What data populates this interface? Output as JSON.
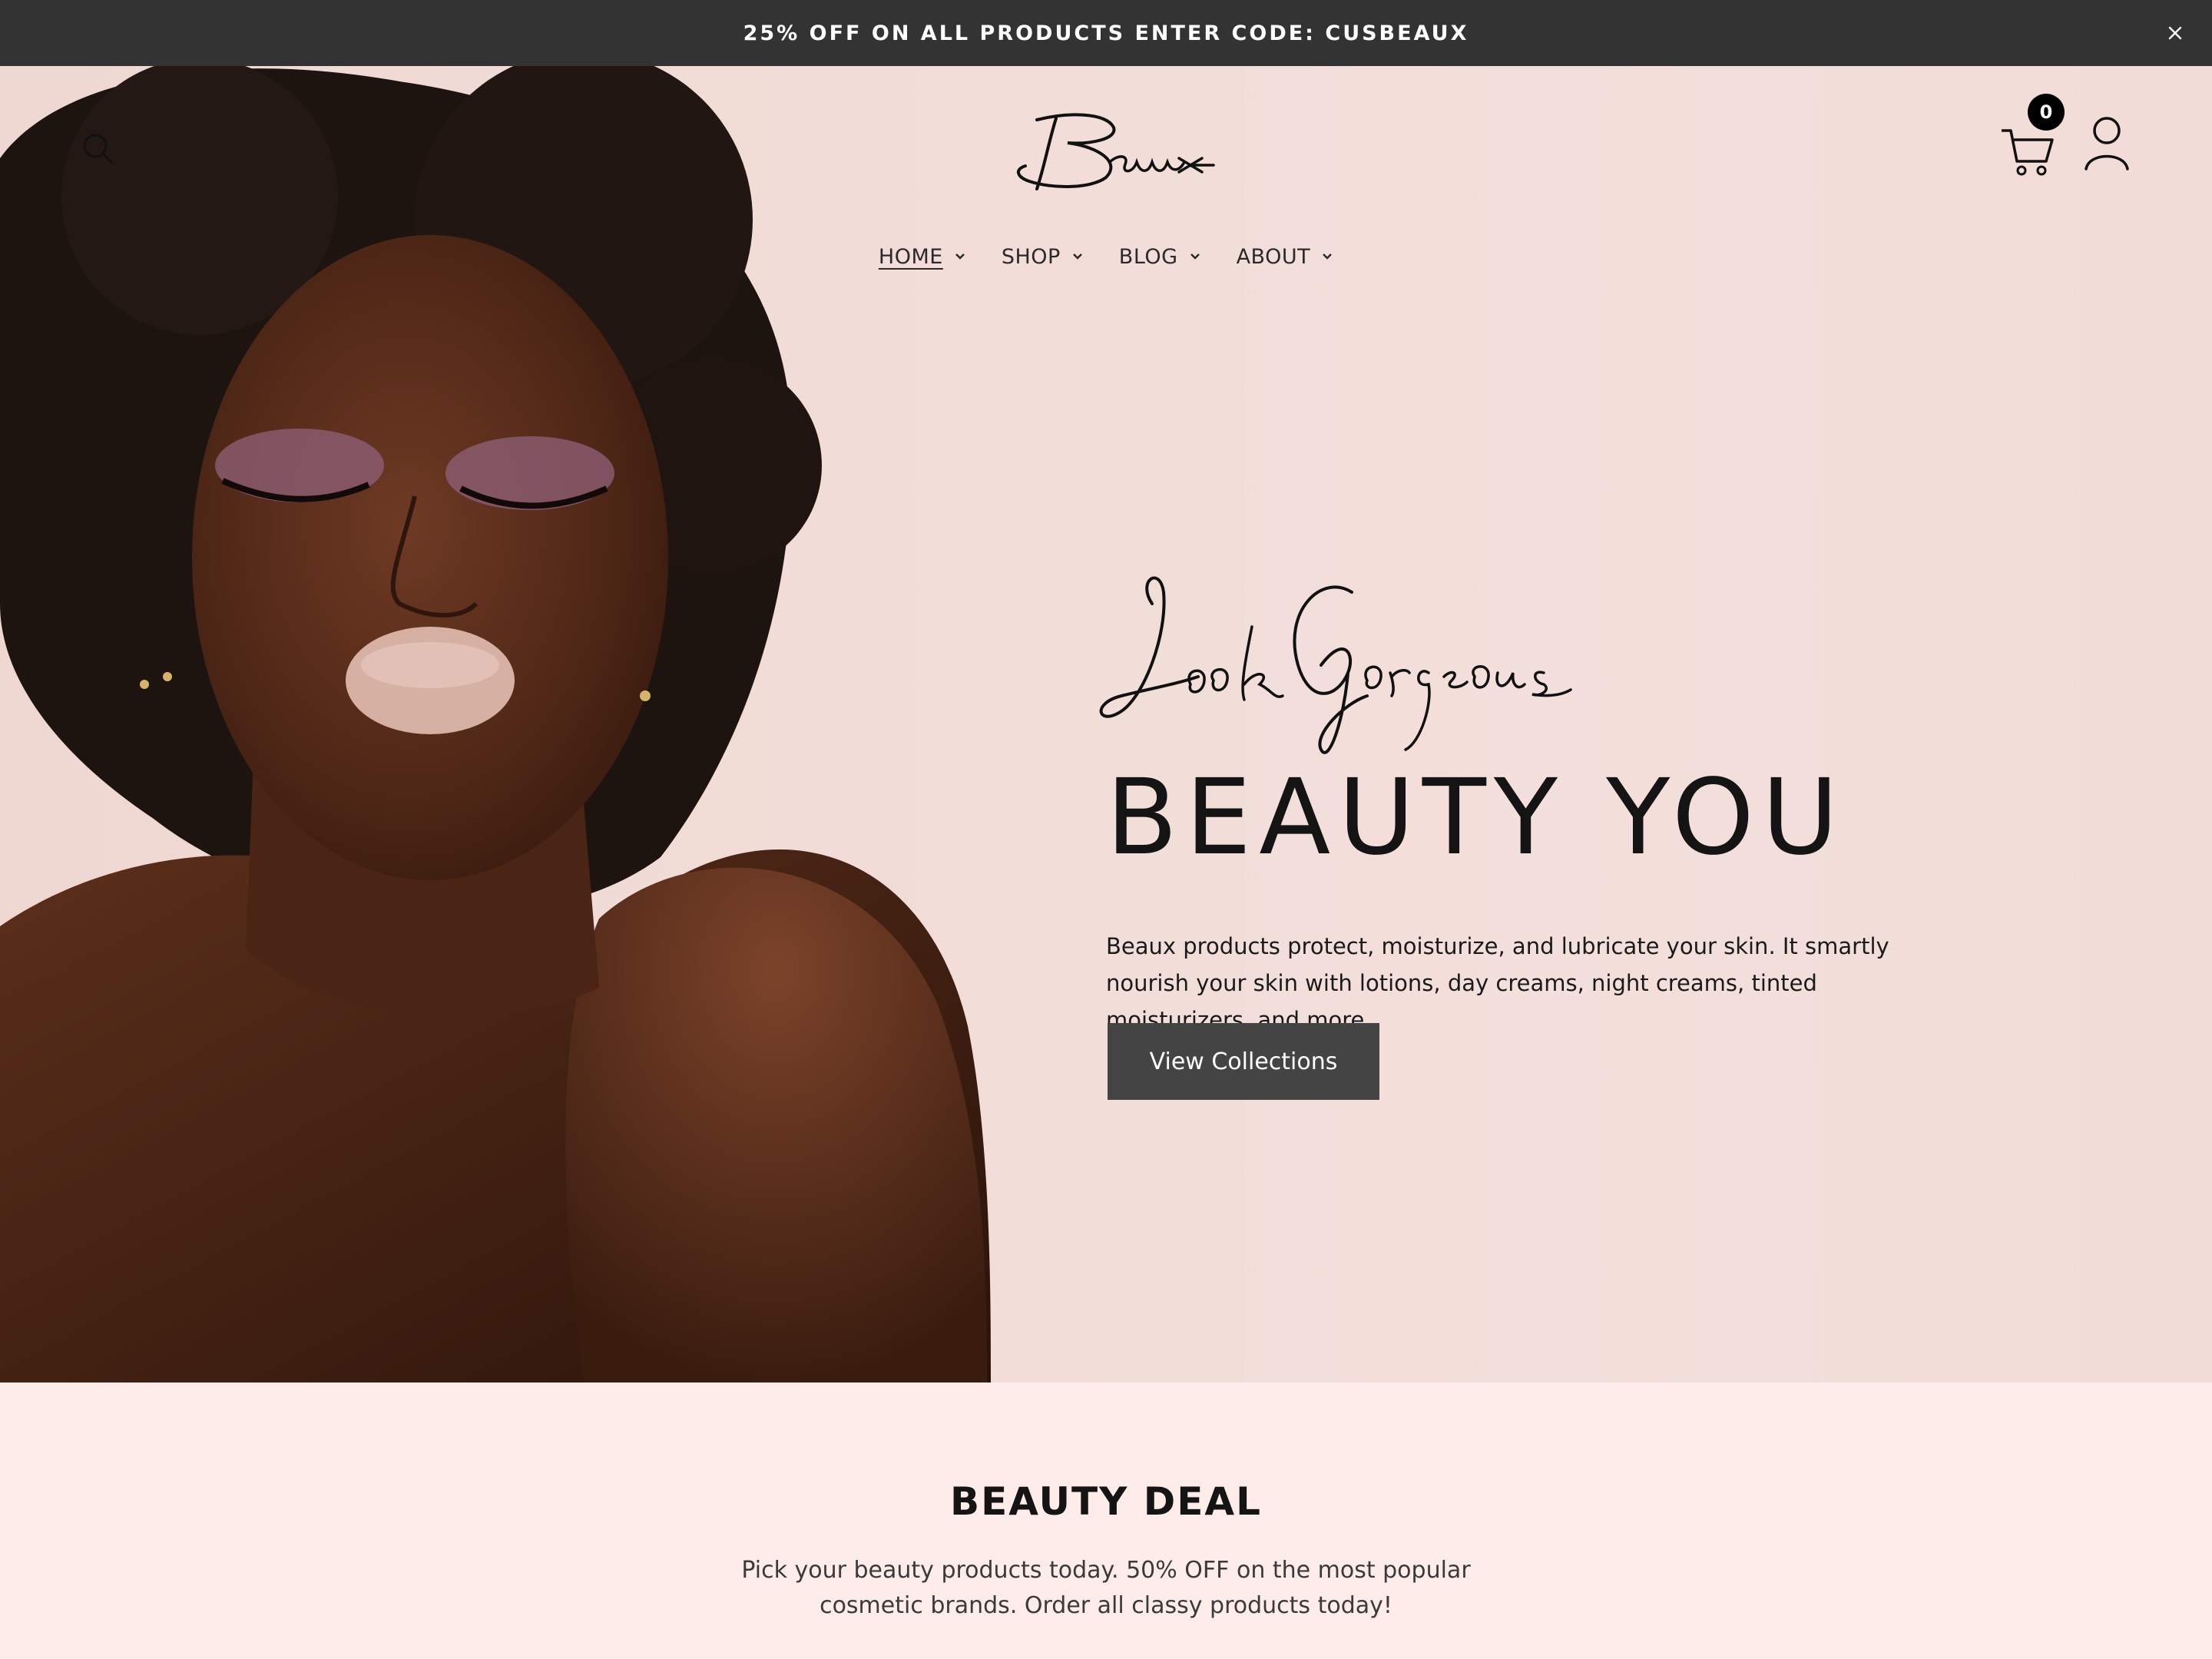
{
  "announcement": {
    "text": "25% OFF ON ALL PRODUCTS ENTER CODE: CUSBEAUX"
  },
  "header": {
    "logo_text": "Beaux",
    "cart_count": "0",
    "icons": [
      "search-icon",
      "cart-icon",
      "account-icon",
      "close-icon",
      "chevron-down-icon"
    ]
  },
  "nav": {
    "items": [
      {
        "label": "HOME",
        "active": true
      },
      {
        "label": "SHOP",
        "active": false
      },
      {
        "label": "BLOG",
        "active": false
      },
      {
        "label": "ABOUT",
        "active": false
      }
    ]
  },
  "hero": {
    "script_text": "Look Gorgeous",
    "title": "BEAUTY YOU",
    "description": "Beaux products protect, moisturize, and lubricate your skin. It smartly nourish your skin with lotions, day creams, night creams, tinted moisturizers, and more.",
    "button_label": "View Collections"
  },
  "deal": {
    "title": "BEAUTY DEAL",
    "text": "Pick your beauty products today. 50% OFF on the most popular cosmetic brands. Order all classy products today!"
  },
  "colors": {
    "announcement_bg": "#333333",
    "hero_bg": "#f2ddd8",
    "button_bg": "#444444",
    "deal_bg": "#fdecea"
  }
}
